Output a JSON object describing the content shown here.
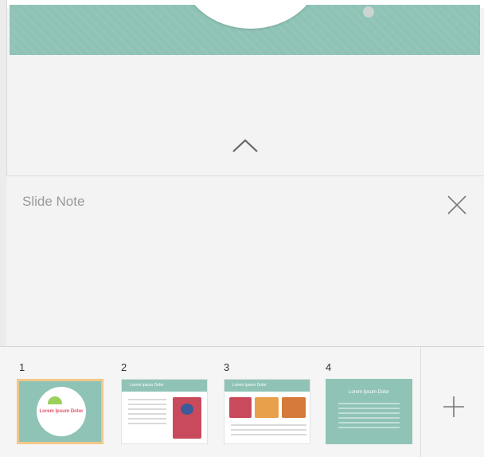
{
  "slide_note": {
    "title": "Slide Note",
    "close_icon": "close-icon",
    "collapse_icon": "chevron-up-icon"
  },
  "thumbnails": [
    {
      "number": "1",
      "title": "Lorem Ipsum Dolor",
      "selected": true
    },
    {
      "number": "2",
      "title": "Lorem Ipsum Dolor",
      "selected": false
    },
    {
      "number": "3",
      "title": "Lorem Ipsum Dolor",
      "selected": false
    },
    {
      "number": "4",
      "title": "Lorem Ipsum Dolor",
      "selected": false
    }
  ],
  "add_slide_icon": "plus-icon",
  "colors": {
    "slide_bg": "#8fc3b6",
    "selection": "#f2c78a",
    "panel_bg": "#f3f3f3"
  }
}
